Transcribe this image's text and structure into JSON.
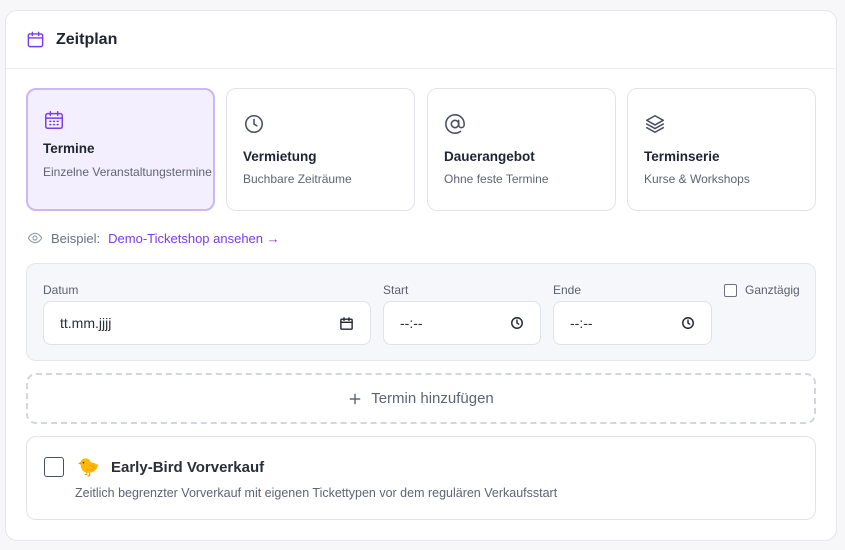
{
  "header": {
    "title": "Zeitplan",
    "icon": "calendar-icon"
  },
  "types": [
    {
      "label": "Termine",
      "desc": "Einzelne Veranstaltungstermine",
      "icon": "calendar-grid-icon",
      "selected": true
    },
    {
      "label": "Vermietung",
      "desc": "Buchbare Zeiträume",
      "icon": "clock-icon",
      "selected": false
    },
    {
      "label": "Dauerangebot",
      "desc": "Ohne feste Termine",
      "icon": "at-sign-icon",
      "selected": false
    },
    {
      "label": "Terminserie",
      "desc": "Kurse & Workshops",
      "icon": "layers-icon",
      "selected": false
    }
  ],
  "example": {
    "label": "Beispiel:",
    "link": "Demo-Ticketshop ansehen →",
    "icon": "eye-icon"
  },
  "date_row": {
    "date_label": "Datum",
    "date_value": "tt.mm.jjjj",
    "start_label": "Start",
    "start_value": "--:--",
    "end_label": "Ende",
    "end_value": "--:--",
    "allday_label": "Ganztägig",
    "allday_checked": false
  },
  "add_button": {
    "label": "Termin hinzufügen",
    "icon": "plus-icon"
  },
  "early_bird": {
    "emoji": "🐤",
    "title": "Early-Bird Vorverkauf",
    "desc": "Zeitlich begrenzter Vorverkauf mit eigenen Tickettypen vor dem regulären Verkaufsstart",
    "checked": false
  },
  "colors": {
    "accent": "#7c3aed",
    "selected_bg": "#f3effe",
    "selected_border": "#c9b8f3"
  }
}
